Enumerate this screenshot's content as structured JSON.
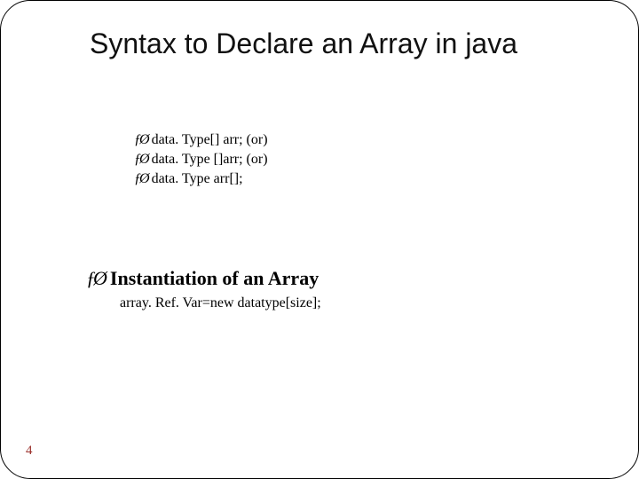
{
  "title": "Syntax to Declare an Array in java",
  "bullet_glyph": "ƒØ",
  "bullets": {
    "items": [
      {
        "text": "data. Type[] arr; (or)"
      },
      {
        "text": "data. Type []arr; (or)"
      },
      {
        "text": "data. Type arr[];"
      }
    ]
  },
  "subhead": "Instantiation of an Array",
  "subline": "array. Ref. Var=new datatype[size];",
  "page_number": "4"
}
